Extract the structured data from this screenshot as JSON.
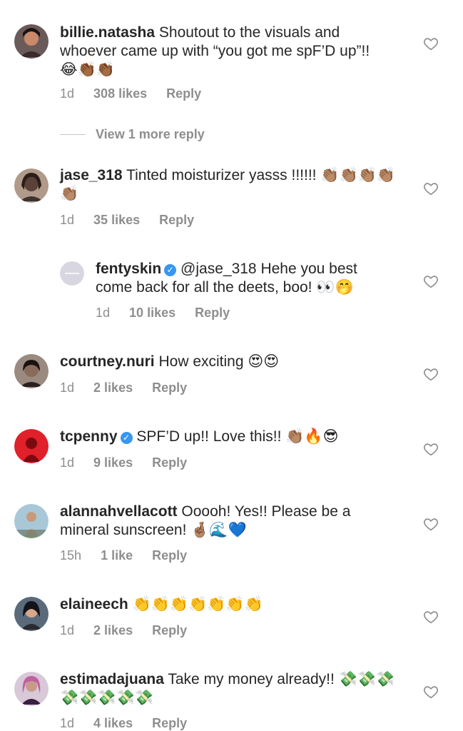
{
  "comments": [
    {
      "username": "billie.natasha",
      "text": "Shoutout to the visuals and whoever came up with “you got me spF’D up”!! 😂👏🏾👏🏾",
      "time": "1d",
      "likes": "308 likes",
      "reply": "Reply",
      "verified": false,
      "avatar_colors": [
        "#c88a6a",
        "#3a2a2a"
      ]
    },
    {
      "username": "jase_318",
      "text": "Tinted moisturizer yasss !!!!!! 👏🏽👏🏽👏🏽👏🏽👏🏽",
      "time": "1d",
      "likes": "35 likes",
      "reply": "Reply",
      "verified": false,
      "avatar_colors": [
        "#b09a8a",
        "#3e3230"
      ]
    },
    {
      "username": "fentyskin",
      "text": "@jase_318 Hehe you best come back for all the deets, boo! 👀🤭",
      "time": "1d",
      "likes": "10 likes",
      "reply": "Reply",
      "verified": true,
      "avatar_colors": [
        "#d8d6e0",
        "#c2bfcc"
      ]
    },
    {
      "username": "courtney.nuri",
      "text": "How exciting 😍😍",
      "time": "1d",
      "likes": "2 likes",
      "reply": "Reply",
      "verified": false,
      "avatar_colors": [
        "#8a6a5a",
        "#2a2020"
      ]
    },
    {
      "username": "tcpenny",
      "text": "SPF’D up!! Love this!! 👏🏽🔥😎",
      "time": "1d",
      "likes": "9 likes",
      "reply": "Reply",
      "verified": true,
      "avatar_colors": [
        "#e0202a",
        "#7a0a10"
      ]
    },
    {
      "username": "alannahvellacott",
      "text": "Ooooh! Yes!! Please be a mineral sunscreen! 🤞🏽🌊💙",
      "time": "15h",
      "likes": "1 like",
      "reply": "Reply",
      "verified": false,
      "avatar_colors": [
        "#a8c8d8",
        "#6a7a6a"
      ]
    },
    {
      "username": "elaineech",
      "text": "👏👏👏👏👏👏👏",
      "time": "1d",
      "likes": "2 likes",
      "reply": "Reply",
      "verified": false,
      "avatar_colors": [
        "#5a6a7a",
        "#2a2a30"
      ]
    },
    {
      "username": "estimadajuana",
      "text": "Take my money already!! 💸💸💸💸💸💸💸💸",
      "time": "1d",
      "likes": "4 likes",
      "reply": "Reply",
      "verified": false,
      "avatar_colors": [
        "#c060a0",
        "#3a2040"
      ]
    }
  ],
  "view_more": "View 1 more reply",
  "icons": {
    "like": "heart-icon",
    "verified": "verified-badge-icon"
  },
  "colors": {
    "text": "#262626",
    "meta": "#8e8e8e",
    "verified": "#3897f0"
  }
}
